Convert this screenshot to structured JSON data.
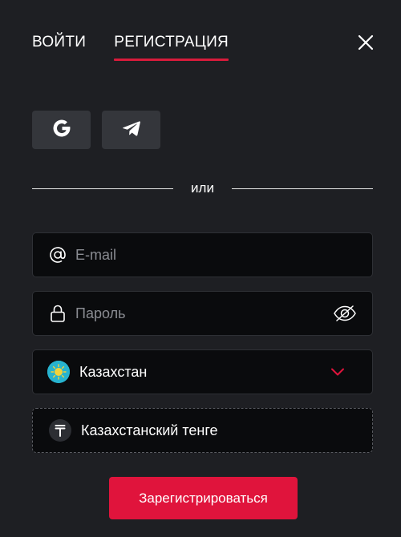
{
  "tabs": [
    {
      "label": "ВОЙТИ",
      "active": false
    },
    {
      "label": "РЕГИСТРАЦИЯ",
      "active": true
    }
  ],
  "header": {
    "close_icon": "close-icon"
  },
  "social": {
    "google_icon": "google-icon",
    "telegram_icon": "telegram-icon"
  },
  "divider": {
    "text": "или"
  },
  "form": {
    "email": {
      "placeholder": "E-mail",
      "value": "",
      "icon": "at-icon"
    },
    "password": {
      "placeholder": "Пароль",
      "value": "",
      "icon": "lock-icon",
      "toggle_icon": "eye-slash-icon"
    },
    "country": {
      "value": "Казахстан",
      "icon": "kazakhstan-flag-icon",
      "chevron": "chevron-down-icon"
    },
    "currency": {
      "value": "Казахстанский тенге",
      "icon": "tenge-icon"
    }
  },
  "submit": {
    "label": "Зарегистрироваться"
  },
  "colors": {
    "background": "#1e1f23",
    "accent": "#e0143c",
    "field_bg": "#0a0b0d",
    "social_bg": "#34363b"
  }
}
